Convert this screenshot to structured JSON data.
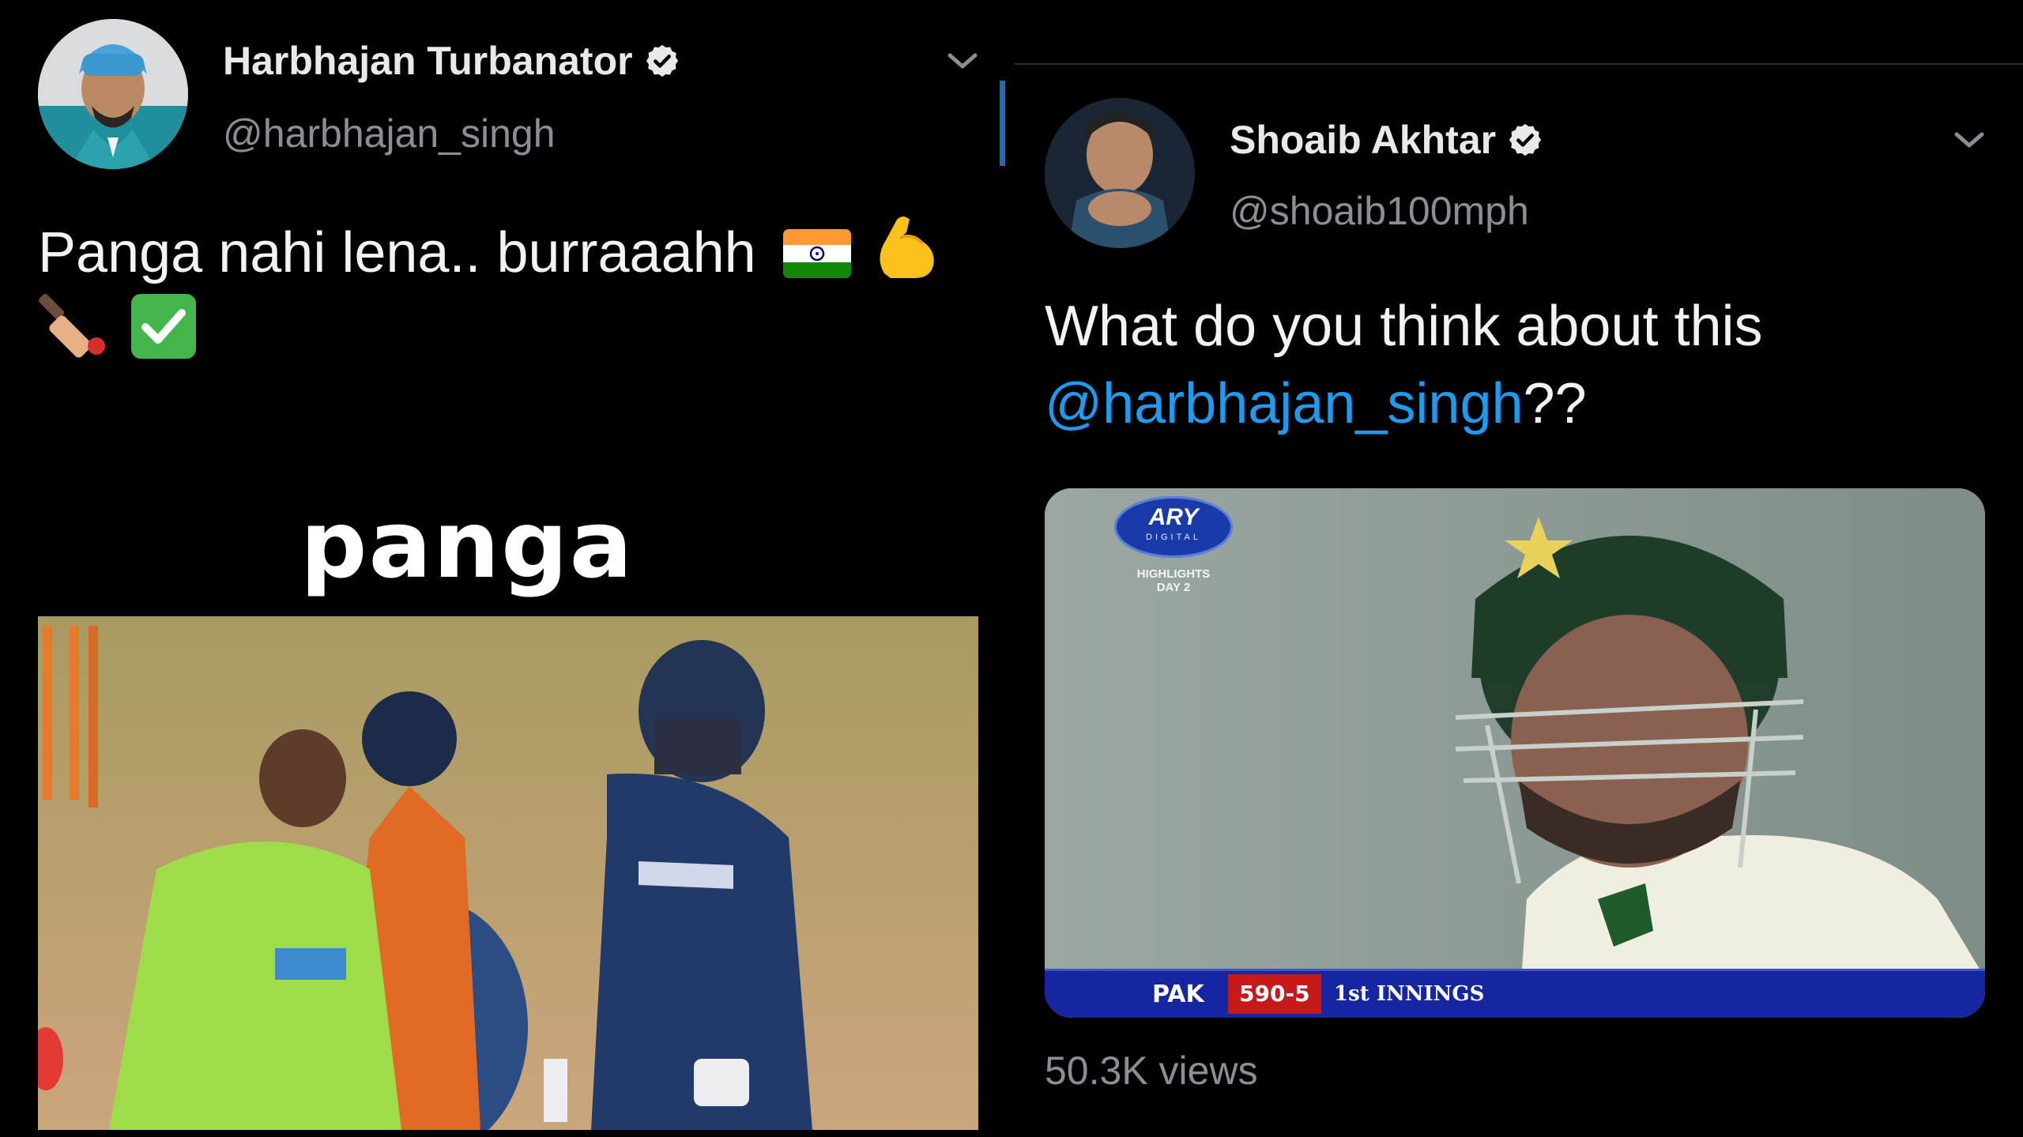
{
  "left_tweet": {
    "author_name": "Harbhajan Turbanator",
    "author_handle": "@harbhajan_singh",
    "text_line1": "Panga nahi lena.. burraaahh",
    "emoji_line1": [
      "india-flag",
      "flexed-biceps"
    ],
    "emoji_line2": [
      "cricket-bat",
      "check-mark-button"
    ],
    "media_caption": "panga"
  },
  "right_tweet": {
    "author_name": "Shoaib Akhtar",
    "author_handle": "@shoaib100mph",
    "text_line1": "What do you think about this",
    "mention": "@harbhajan_singh",
    "text_suffix": "??",
    "broadcast": {
      "channel_logo": "ARY",
      "channel_sub": "DIGITAL",
      "overlay_line1": "HIGHLIGHTS",
      "overlay_line2": "DAY 2",
      "team": "PAK",
      "score": "590-5",
      "innings": "1st INNINGS"
    },
    "views": "50.3K views"
  },
  "colors": {
    "background": "#000000",
    "link": "#1d9bf0",
    "secondary_text": "#8b8f95",
    "divider_accent": "#1d6fb5"
  }
}
